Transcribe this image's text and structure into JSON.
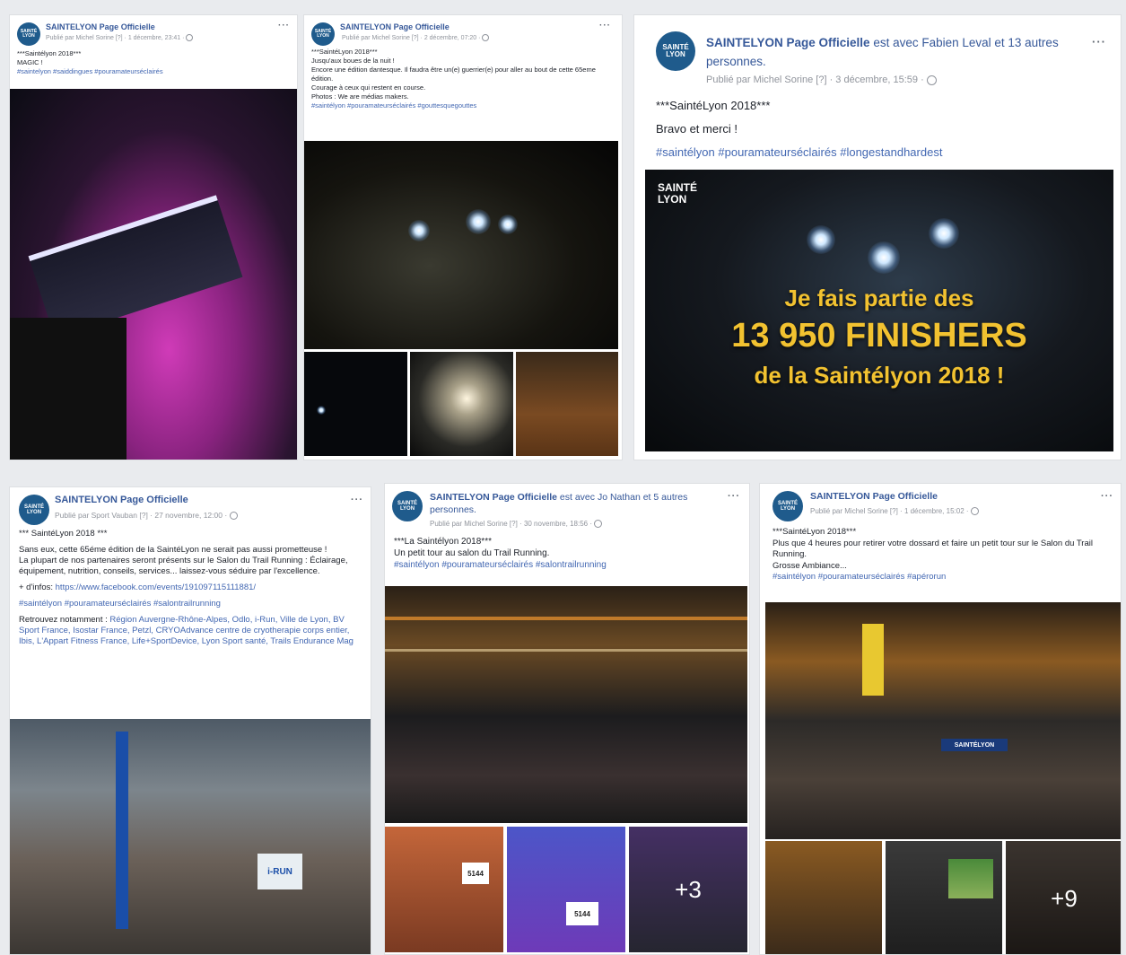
{
  "page_name": "SAINTELYON Page Officielle",
  "avatar_text": [
    "SAINTÉ",
    "LYON"
  ],
  "menu_dots": "···",
  "posts": [
    {
      "with": "",
      "meta": "Publié par Michel Sorine [?] · 1 décembre, 23:41 ·",
      "lines": [
        "***Saintélyon 2018***",
        "MAGIC !"
      ],
      "tags": "#saintelyon #saiddingues #pouramateurséclairés"
    },
    {
      "with": "",
      "meta": "Publié par Michel Sorine [?] · 2 décembre, 07:20 ·",
      "lines": [
        "***SaintéLyon 2018***",
        "Jusqu'aux boues de la nuit !",
        "Encore une édition dantesque. Il faudra être un(e) guerrier(e) pour aller au bout de cette 65eme édition.",
        "Courage à ceux qui restent en course.",
        "Photos : We are médias makers."
      ],
      "tags": "#saintélyon #pouramateurséclairés #gouttesquegouttes"
    },
    {
      "with": " est avec Fabien Leval et 13 autres personnes.",
      "meta": "Publié par Michel Sorine [?] · 3 décembre, 15:59 ·",
      "lines": [
        "***SaintéLyon 2018***",
        "Bravo et merci !"
      ],
      "tags": "#saintélyon #pouramateurséclairés #longestandhardest",
      "banner": {
        "logo": [
          "SAINTÉ",
          "LYON"
        ],
        "line1": "Je fais partie des",
        "line2": "13 950 FINISHERS",
        "line3": "de la Saintélyon 2018 !"
      }
    },
    {
      "with": "",
      "meta": "Publié par Sport Vauban [?] · 27 novembre, 12:00 ·",
      "lines": [
        "*** SaintéLyon 2018 ***",
        "Sans eux, cette 65éme édition de la SaintéLyon ne serait pas aussi prometteuse !",
        "La plupart de nos partenaires seront présents sur le Salon du Trail Running : Éclairage, équipement, nutrition, conseils, services... laissez-vous séduire par l'excellence."
      ],
      "info_label": "+ d'infos: ",
      "info_link": "https://www.facebook.com/events/191097115111881/",
      "tags": "#saintélyon #pouramateurséclairés #salontrailrunning",
      "retrouvez_label": "Retrouvez notamment : ",
      "retrouvez": "Région Auvergne-Rhône-Alpes, Odlo, i-Run, Ville de Lyon, BV Sport France, Isostar France, Petzl, CRYOAdvance centre de cryotherapie corps entier, Ibis, L'Appart Fitness France, Life+SportDevice, Lyon Sport santé, Trails Endurance Mag",
      "photo_sign": "i-RUN"
    },
    {
      "with": " est avec Jo Nathan et 5 autres personnes.",
      "meta": "Publié par Michel Sorine [?] · 30 novembre, 18:56 ·",
      "lines": [
        "***La Saintélyon 2018***",
        "Un petit tour au salon du Trail Running."
      ],
      "tags": "#saintélyon #pouramateurséclairés #salontrailrunning",
      "more": "+3",
      "bib": "5144"
    },
    {
      "with": "",
      "meta": "Publié par Michel Sorine [?] · 1 décembre, 15:02 ·",
      "lines": [
        "***SaintéLyon 2018***",
        "Plus que 4 heures pour retirer votre dossard et faire un petit tour sur le Salon du Trail Running.",
        "Grosse Ambiance..."
      ],
      "tags": "#saintélyon #pouramateurséclairés #apérorun",
      "more": "+9",
      "sign": "SAINTÉLYON"
    }
  ]
}
